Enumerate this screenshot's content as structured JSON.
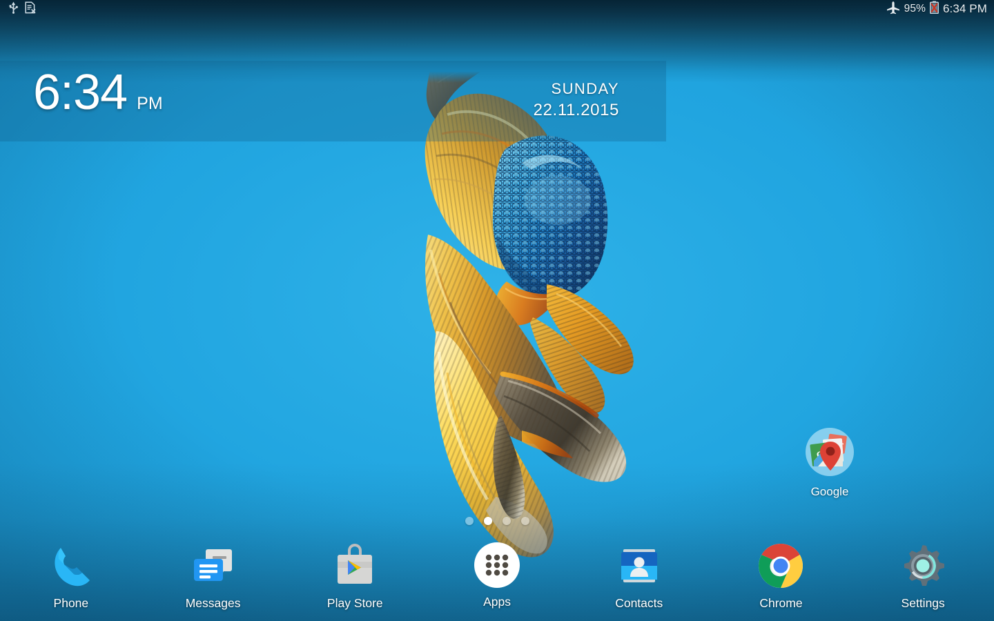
{
  "status_bar": {
    "left_icons": [
      {
        "name": "usb-icon",
        "glyph": "usb"
      },
      {
        "name": "no-sim-icon",
        "glyph": "sim-card-error"
      }
    ],
    "right": {
      "airplane_icon": "airplane-mode-icon",
      "battery_percent": "95%",
      "battery_icon": "battery-charging-error-icon",
      "clock": "6:34 PM"
    }
  },
  "clock_widget": {
    "time": "6:34",
    "ampm": "PM",
    "weekday": "SUNDAY",
    "date": "22.11.2015"
  },
  "desktop": {
    "icons": [
      {
        "name": "google-folder",
        "label": "Google",
        "icon": "google-folder-icon"
      }
    ]
  },
  "page_indicator": {
    "count": 4,
    "active_index": 1
  },
  "dock": {
    "items": [
      {
        "name": "phone",
        "label": "Phone",
        "icon": "phone-icon"
      },
      {
        "name": "messages",
        "label": "Messages",
        "icon": "messages-icon"
      },
      {
        "name": "play-store",
        "label": "Play Store",
        "icon": "play-store-icon"
      },
      {
        "name": "apps",
        "label": "Apps",
        "icon": "apps-grid-icon"
      },
      {
        "name": "contacts",
        "label": "Contacts",
        "icon": "contacts-icon"
      },
      {
        "name": "chrome",
        "label": "Chrome",
        "icon": "chrome-icon"
      },
      {
        "name": "settings",
        "label": "Settings",
        "icon": "settings-gear-icon"
      }
    ]
  },
  "colors": {
    "wallpaper_blue": "#21a5e0",
    "status_bar_dark": "#062434",
    "widget_overlay": "rgba(16,92,136,0.30)",
    "accent_white": "#ffffff",
    "fish_gold": "#e8a926",
    "fish_blue": "#2e9fe0",
    "fish_dark": "#4a4036"
  }
}
